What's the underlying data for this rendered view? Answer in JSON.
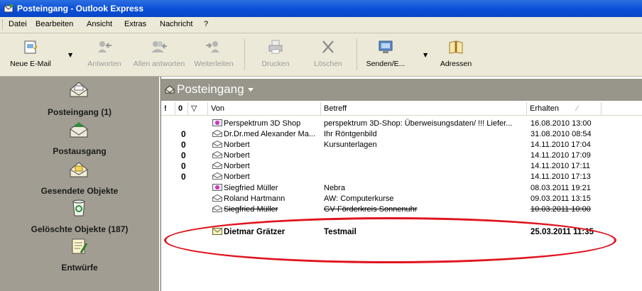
{
  "window": {
    "title": "Posteingang - Outlook Express"
  },
  "menu": [
    "Datei",
    "Bearbeiten",
    "Ansicht",
    "Extras",
    "Nachricht",
    "?"
  ],
  "toolbar": {
    "new_mail": "Neue E-Mail",
    "reply": "Antworten",
    "reply_all": "Allen antworten",
    "forward": "Weiterleiten",
    "print": "Drucken",
    "delete": "Löschen",
    "send_receive": "Senden/E...",
    "addresses": "Adressen"
  },
  "sidebar": {
    "items": [
      {
        "label": "Posteingang (1)",
        "icon": "inbox-icon"
      },
      {
        "label": "Postausgang",
        "icon": "outbox-icon"
      },
      {
        "label": "Gesendete Objekte",
        "icon": "sent-items-icon"
      },
      {
        "label": "Gelöschte Objekte (187)",
        "icon": "recycle-bin-icon"
      },
      {
        "label": "Entwürfe",
        "icon": "drafts-icon"
      }
    ]
  },
  "folder": {
    "title": "Posteingang"
  },
  "list": {
    "columns": {
      "priority": "!",
      "attachment": "0",
      "flag": "▽",
      "from": "Von",
      "subject": "Betreff",
      "received": "Erhalten",
      "sort_indicator": "⁄"
    },
    "rows": [
      {
        "attach": "",
        "from": "Perspektrum 3D Shop",
        "subject": "perspektrum 3D-Shop: Überweisungsdaten/ !!! Liefer...",
        "date": "16.08.2010 13:00",
        "icon": "web-mail-icon"
      },
      {
        "attach": "0",
        "from": "Dr.Dr.med Alexander Ma...",
        "subject": "Ihr Röntgenbild",
        "date": "31.08.2010 08:54",
        "icon": "read-mail-icon"
      },
      {
        "attach": "0",
        "from": "Norbert",
        "subject": "Kursunterlagen",
        "date": "14.11.2010 17:04",
        "icon": "read-mail-icon"
      },
      {
        "attach": "0",
        "from": "Norbert",
        "subject": "",
        "date": "14.11.2010 17:09",
        "icon": "read-mail-icon"
      },
      {
        "attach": "0",
        "from": "Norbert",
        "subject": "",
        "date": "14.11.2010 17:11",
        "icon": "read-mail-icon"
      },
      {
        "attach": "0",
        "from": "Norbert",
        "subject": "",
        "date": "14.11.2010 17:13",
        "icon": "read-mail-icon"
      },
      {
        "attach": "",
        "from": "Siegfried Müller",
        "subject": "Nebra",
        "date": "08.03.2011 19:21",
        "icon": "web-mail-icon"
      },
      {
        "attach": "",
        "from": "Roland Hartmann",
        "subject": "AW: Computerkurse",
        "date": "09.03.2011 13:15",
        "icon": "read-mail-icon"
      },
      {
        "attach": "",
        "from": "Siegfried Müller",
        "subject": "GV Förderkreis Sonnenuhr",
        "date": "10.03.2011 10:00",
        "icon": "read-mail-icon"
      },
      {
        "attach": "",
        "from": "Dietmar Grätzer",
        "subject": "Testmail",
        "date": "25.03.2011 11:35",
        "icon": "unread-mail-icon",
        "unread": true
      }
    ]
  },
  "colors": {
    "title_bar": "#0a4ed8",
    "sidebar": "#a19d92",
    "folder_bar": "#98958a",
    "annotation": "#e0141e"
  }
}
